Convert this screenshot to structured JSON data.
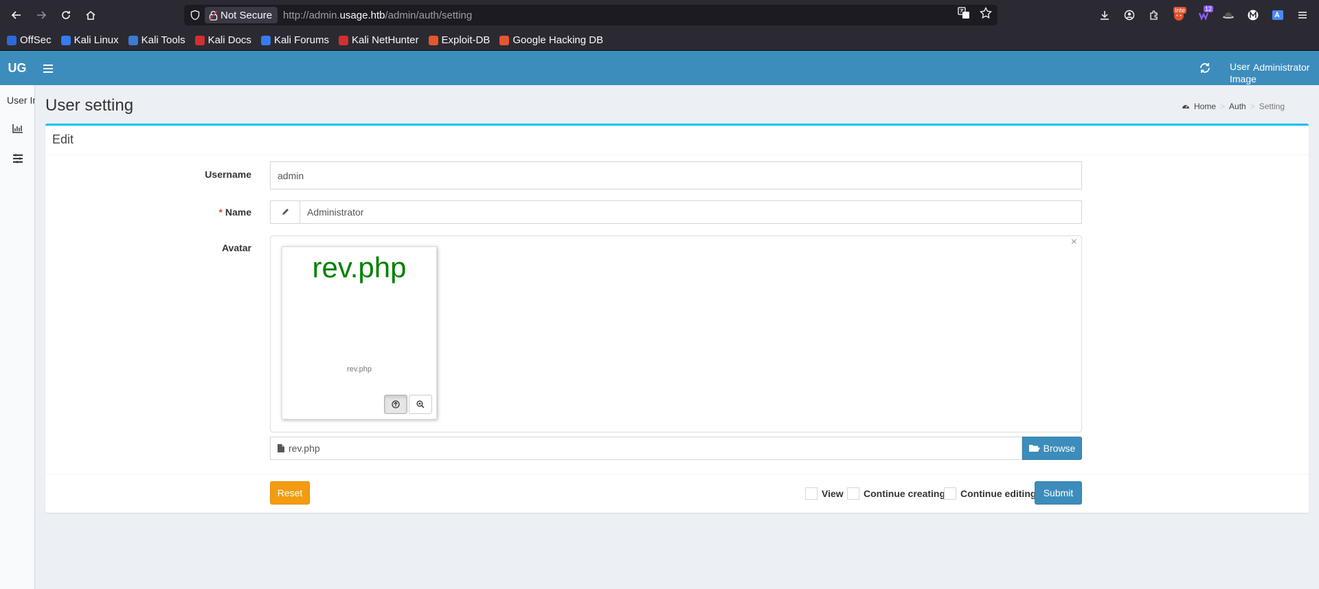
{
  "browser": {
    "not_secure_label": "Not Secure",
    "url_prefix": "http://admin.",
    "url_host": "usage.htb",
    "url_path": "/admin/auth/setting",
    "ext_badge_count": "12",
    "ext_badge_inte": "Inte"
  },
  "bookmarks": [
    {
      "label": "OffSec",
      "color": "#2a6bd8"
    },
    {
      "label": "Kali Linux",
      "color": "#367bf0"
    },
    {
      "label": "Kali Tools",
      "color": "#3a7bd5"
    },
    {
      "label": "Kali Docs",
      "color": "#d32f2f"
    },
    {
      "label": "Kali Forums",
      "color": "#367bf0"
    },
    {
      "label": "Kali NetHunter",
      "color": "#d32f2f"
    },
    {
      "label": "Exploit-DB",
      "color": "#e4572e"
    },
    {
      "label": "Google Hacking DB",
      "color": "#e4572e"
    }
  ],
  "header": {
    "logo": "UG",
    "user_image_alt": "User Image",
    "user_name": "Administrator",
    "brand_color": "#3c8dbc"
  },
  "sidebar": {
    "user_label": "User In"
  },
  "page": {
    "title": "User setting",
    "breadcrumb": {
      "home": "Home",
      "auth": "Auth",
      "setting": "Setting"
    }
  },
  "form": {
    "box_title": "Edit",
    "username_label": "Username",
    "username_value": "admin",
    "name_required_mark": "*",
    "name_label": "Name",
    "name_value": "Administrator",
    "avatar_label": "Avatar",
    "close_glyph": "×",
    "preview_title": "rev.php",
    "preview_caption": "rev.php",
    "file_caption": "rev.php",
    "browse_label": "Browse"
  },
  "footer": {
    "reset_label": "Reset",
    "view_label": "View",
    "continue_creating_label": "Continue creating",
    "continue_editing_label": "Continue editing",
    "submit_label": "Submit"
  }
}
